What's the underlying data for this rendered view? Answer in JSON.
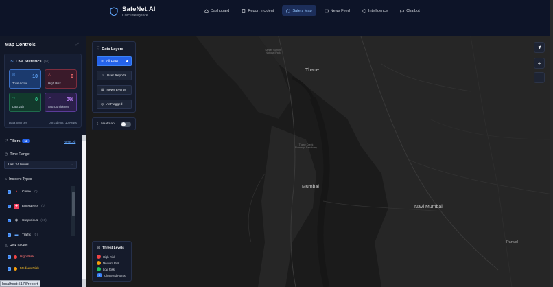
{
  "brand": {
    "name": "SafeNet.AI",
    "subtitle": "Civic Intelligence"
  },
  "nav": [
    {
      "label": "Dashboard",
      "icon": "home-icon",
      "active": false
    },
    {
      "label": "Report Incident",
      "icon": "document-icon",
      "active": false
    },
    {
      "label": "Safety Map",
      "icon": "map-icon",
      "active": true
    },
    {
      "label": "News Feed",
      "icon": "news-icon",
      "active": false
    },
    {
      "label": "Intelligence",
      "icon": "brain-icon",
      "active": false
    },
    {
      "label": "Chatbot",
      "icon": "chat-icon",
      "active": false
    }
  ],
  "panel": {
    "title": "Map Controls",
    "stats": {
      "title": "Live Statistics",
      "scope": "(All)",
      "total_active": {
        "value": "10",
        "label": "Total Active"
      },
      "high_risk": {
        "value": "0",
        "label": "High Risk"
      },
      "last_24h": {
        "value": "0",
        "label": "Last 24h"
      },
      "avg_confidence": {
        "value": "0%",
        "label": "Avg Confidence"
      },
      "data_sources_label": "Data Sources",
      "data_sources_value": "0 Incidents, 10 News"
    },
    "filters": {
      "title": "Filters",
      "count": "13",
      "reset_label": "Reset All",
      "time_range_label": "Time Range",
      "time_range_value": "Last 24 Hours",
      "incident_types_label": "Incident Types",
      "incident_types": [
        {
          "label": "Crime",
          "count": "(0)",
          "icon": "crime-icon",
          "color": "#ef4444"
        },
        {
          "label": "Emergency",
          "count": "(0)",
          "icon": "emergency-icon",
          "color": "#f43f5e"
        },
        {
          "label": "Suspicious",
          "count": "(10)",
          "icon": "eye-icon",
          "color": "#e5e7eb"
        },
        {
          "label": "Traffic",
          "count": "(0)",
          "icon": "car-icon",
          "color": "#60a5fa"
        }
      ],
      "risk_levels_label": "Risk Levels",
      "risk_levels": [
        {
          "label": "High Risk",
          "color": "#ef4444"
        },
        {
          "label": "Medium Risk",
          "color": "#f59e0b"
        }
      ]
    }
  },
  "layers": {
    "title": "Data Layers",
    "items": [
      {
        "label": "All Data",
        "icon": "stack-icon",
        "active": true
      },
      {
        "label": "User Reports",
        "icon": "users-icon",
        "active": false
      },
      {
        "label": "News Events",
        "icon": "newspaper-icon",
        "active": false
      },
      {
        "label": "AI Flagged",
        "icon": "ai-icon",
        "active": false
      }
    ],
    "heatmap_label": "Heatmap"
  },
  "legend": {
    "title": "Threat Levels",
    "items": [
      {
        "label": "High Risk",
        "color": "#ef4444"
      },
      {
        "label": "Medium Risk",
        "color": "#f59e0b"
      },
      {
        "label": "Low Risk",
        "color": "#22c55e"
      },
      {
        "label": "Clustered Points",
        "color": "#3b82f6"
      }
    ],
    "cluster_glyph": "5"
  },
  "map": {
    "places": {
      "thane": "Thane",
      "mumbai": "Mumbai",
      "navi_mumbai": "Navi Mumbai",
      "panvel": "Panvel",
      "sanjay_gandhi": "Sanjay Gandhi National Park",
      "thane_creek": "Thane Creek Flamingo Sanctuary"
    }
  },
  "status_url": "localhost:5173/report"
}
